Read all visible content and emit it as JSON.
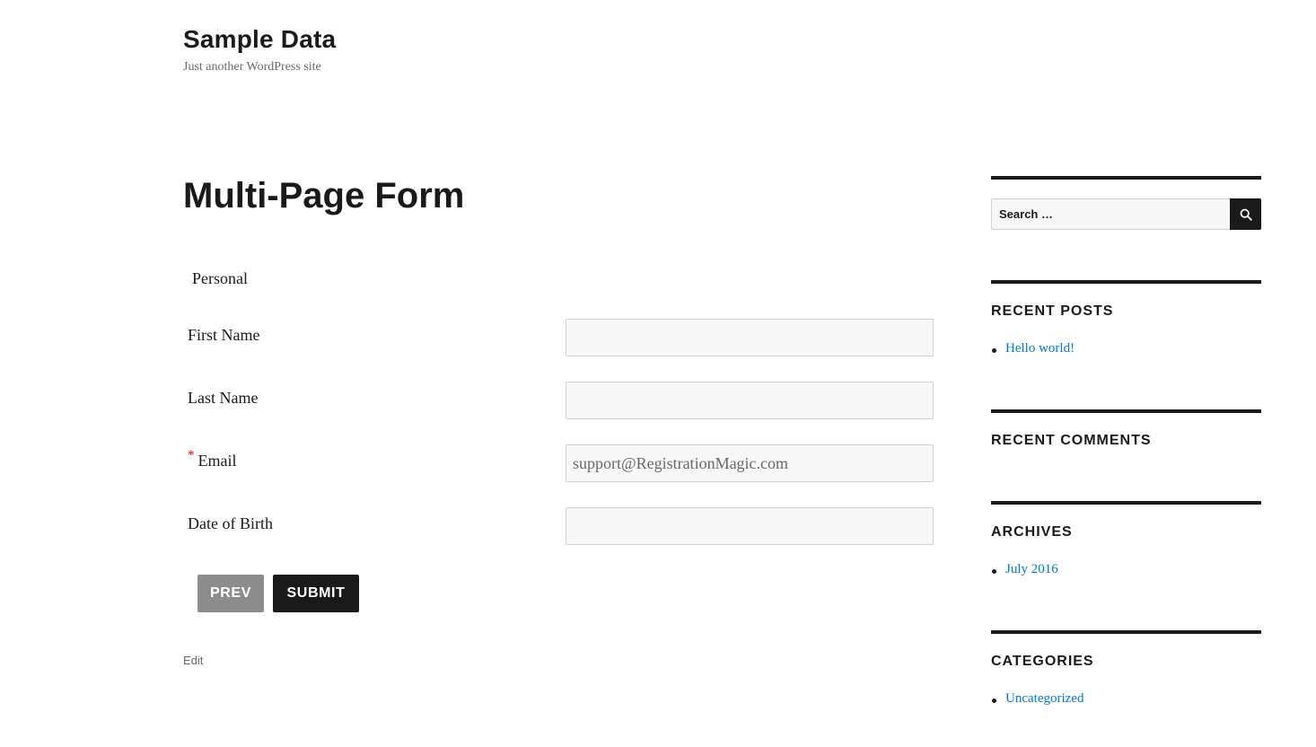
{
  "site": {
    "title": "Sample Data",
    "description": "Just another WordPress site"
  },
  "page": {
    "title": "Multi-Page Form",
    "edit_label": "Edit"
  },
  "form": {
    "section_label": "Personal",
    "fields": [
      {
        "label": "First Name",
        "value": "",
        "required": false
      },
      {
        "label": "Last Name",
        "value": "",
        "required": false
      },
      {
        "label": "Email",
        "value": "support@RegistrationMagic.com",
        "required": true
      },
      {
        "label": "Date of Birth",
        "value": "",
        "required": false
      }
    ],
    "required_marker": "*",
    "prev_label": "PREV",
    "submit_label": "SUBMIT"
  },
  "sidebar": {
    "search": {
      "placeholder": "Search …",
      "icon": "search-icon"
    },
    "recent_posts": {
      "title": "RECENT POSTS",
      "items": [
        "Hello world!"
      ]
    },
    "recent_comments": {
      "title": "RECENT COMMENTS",
      "items": []
    },
    "archives": {
      "title": "ARCHIVES",
      "items": [
        "July 2016"
      ]
    },
    "categories": {
      "title": "CATEGORIES",
      "items": [
        "Uncategorized"
      ]
    }
  },
  "colors": {
    "text": "#1a1a1a",
    "link": "#007acc",
    "required": "#e00000",
    "prev_button": "#8c8c8c",
    "submit_button": "#1a1a1a"
  }
}
